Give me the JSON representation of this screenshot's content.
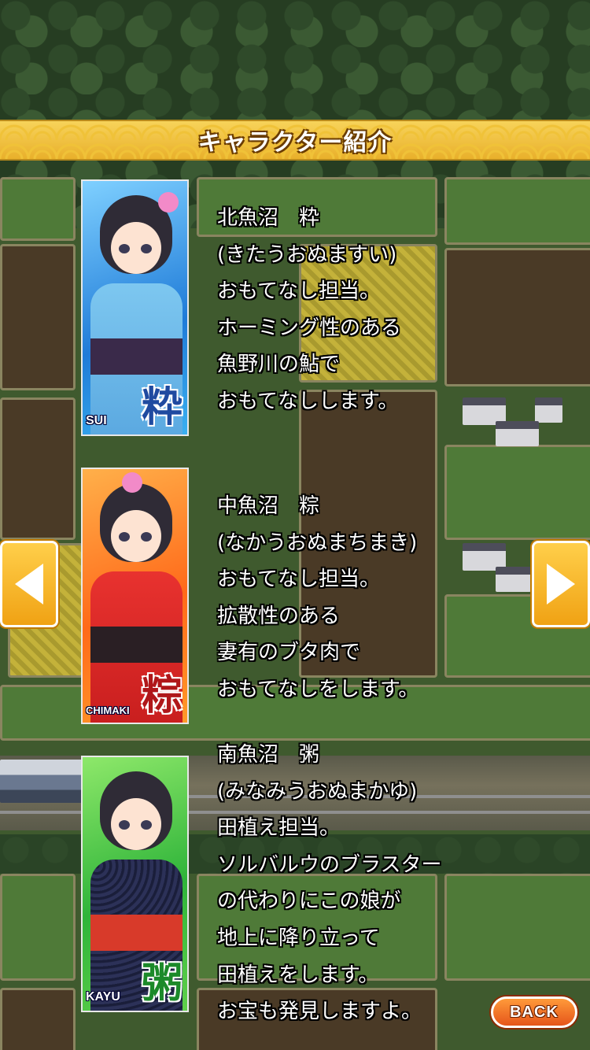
{
  "header": {
    "title": "キャラクター紹介"
  },
  "characters": [
    {
      "tag": "SUI",
      "kanji": "粋",
      "lines": [
        "北魚沼　粋",
        "(きたうおぬますい)",
        "おもてなし担当。",
        "ホーミング性のある",
        "魚野川の鮎で",
        "おもてなしします。"
      ]
    },
    {
      "tag": "CHIMAKI",
      "kanji": "粽",
      "lines": [
        "中魚沼　粽",
        "(なかうおぬまちまき)",
        "おもてなし担当。",
        "拡散性のある",
        "妻有のブタ肉で",
        "おもてなしをします。"
      ]
    },
    {
      "tag": "KAYU",
      "kanji": "粥",
      "lines": [
        "南魚沼　粥",
        "(みなみうおぬまかゆ)",
        "田植え担当。",
        "ソルバルウのブラスター",
        "の代わりにこの娘が",
        "地上に降り立って",
        "田植えをします。",
        "お宝も発見しますよ。"
      ]
    }
  ],
  "nav": {
    "back_label": "BACK",
    "prev_icon": "arrow-left-icon",
    "next_icon": "arrow-right-icon"
  },
  "colors": {
    "banner": "#f0c238",
    "arrow": "#f0a214",
    "back_button": "#e5551a"
  }
}
